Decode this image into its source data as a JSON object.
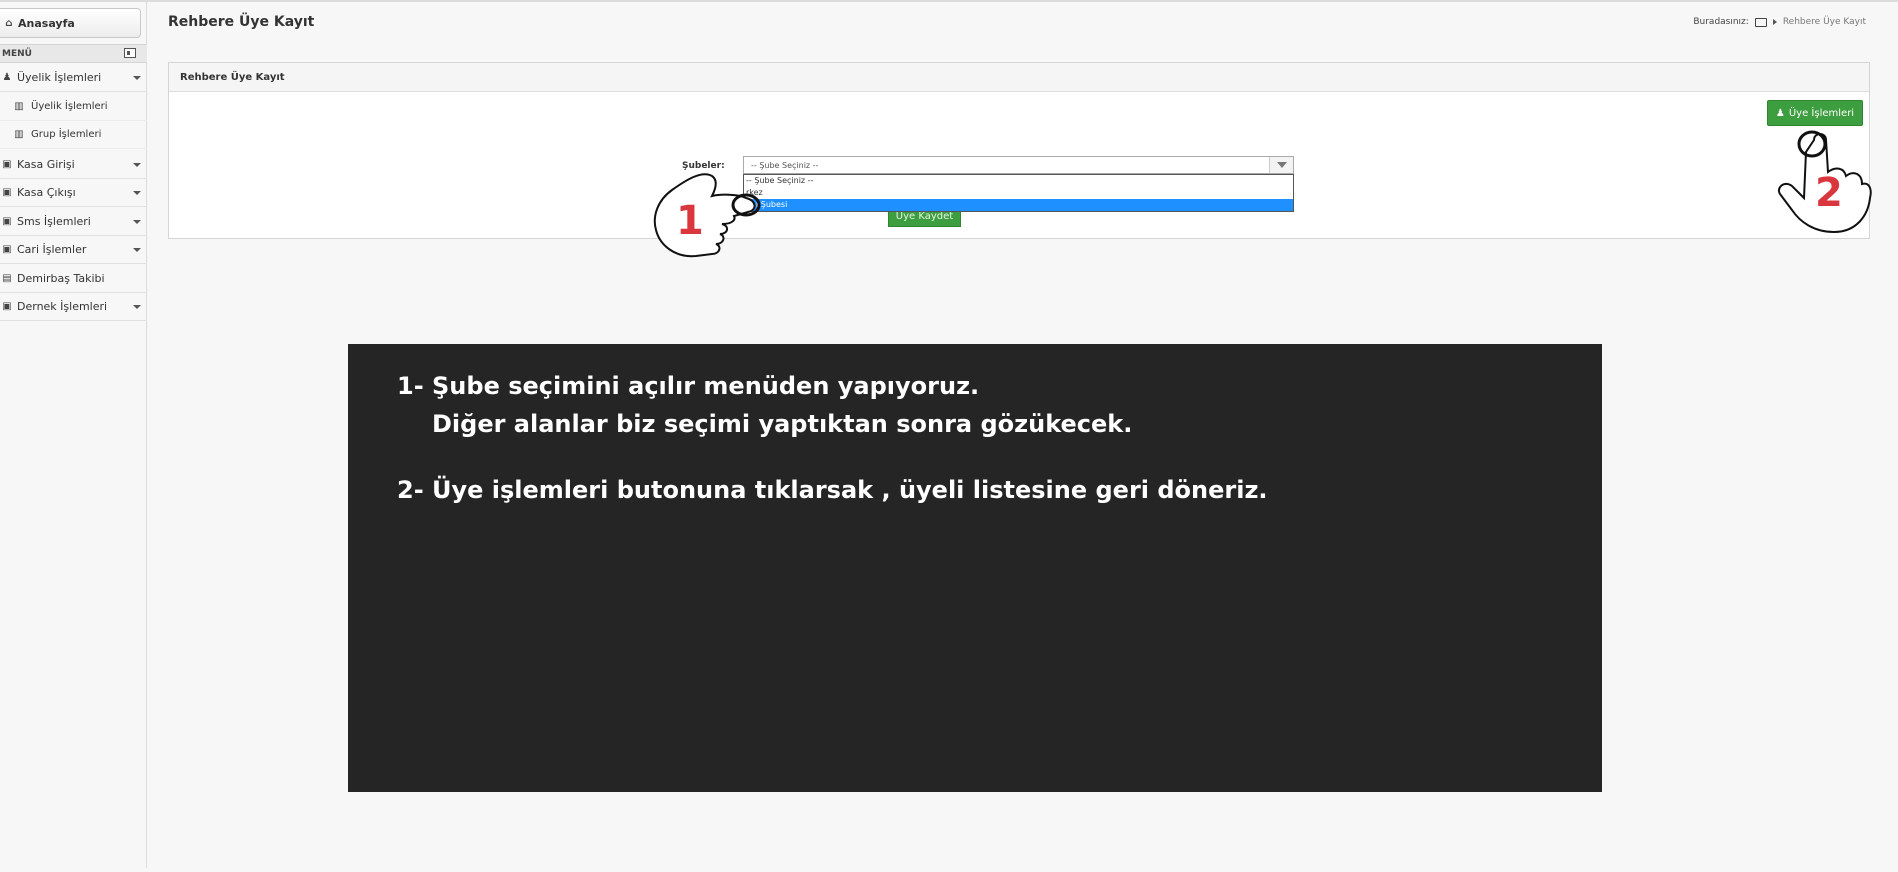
{
  "sidebar": {
    "home_label": "Anasayfa",
    "menu_label": "MENÜ",
    "items": [
      {
        "label": "Üyelik İşlemleri",
        "icon": "user-icon",
        "expandable": true
      },
      {
        "label": "Üyelik İşlemleri",
        "icon": "book-icon",
        "sub": true
      },
      {
        "label": "Grup İşlemleri",
        "icon": "book-icon",
        "sub": true
      },
      {
        "label": "Kasa Girişi",
        "icon": "lock-icon",
        "expandable": true
      },
      {
        "label": "Kasa Çıkışı",
        "icon": "lock-icon",
        "expandable": true
      },
      {
        "label": "Sms İşlemleri",
        "icon": "lock-icon",
        "expandable": true
      },
      {
        "label": "Cari İşlemler",
        "icon": "lock-icon",
        "expandable": true
      },
      {
        "label": "Demirbaş Takibi",
        "icon": "building-icon",
        "expandable": false
      },
      {
        "label": "Dernek İşlemleri",
        "icon": "lock-icon",
        "expandable": true
      }
    ]
  },
  "header": {
    "title": "Rehbere Üye Kayıt",
    "breadcrumb_label": "Buradasınız:",
    "breadcrumb_current": "Rehbere Üye Kayıt"
  },
  "panel": {
    "title": "Rehbere Üye Kayıt",
    "uye_button": "Üye İşlemleri",
    "field_label": "Şubeler:",
    "select_value": "-- Şube Seçiniz --",
    "options": [
      "-- Şube Seçiniz --",
      "rkez",
      "gal Şubesi"
    ],
    "selected_option_index": 2,
    "save_button": "Üye Kaydet"
  },
  "annotations": {
    "hand1_number": "1",
    "hand2_number": "2"
  },
  "info": {
    "line1": "1- Şube seçimini açılır menüden yapıyoruz.",
    "line2": "Diğer alanlar biz seçimi yaptıktan sonra gözükecek.",
    "line3": "2- Üye işlemleri butonuna tıklarsak , üyeli listesine geri döneriz."
  },
  "colors": {
    "accent_green": "#3d9e3f",
    "selection_blue": "#1e90ff",
    "annotation_red": "#d9363e",
    "info_bg": "#252525"
  }
}
